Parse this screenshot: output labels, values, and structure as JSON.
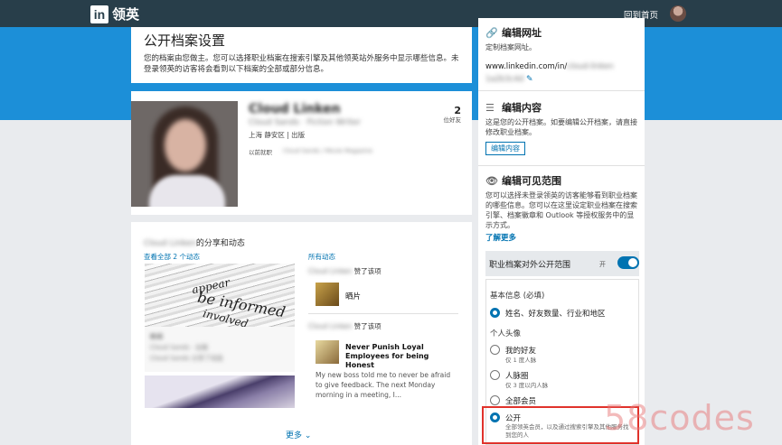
{
  "topbar": {
    "logo_mark": "in",
    "logo_text": "领英",
    "home_link": "回到首页"
  },
  "title_card": {
    "title": "公开档案设置",
    "description": "您的档案由您做主。您可以选择职业档案在搜索引擎及其他领英站外服务中显示哪些信息。未登录领英的访客将会看到以下档案的全部或部分信息。"
  },
  "profile": {
    "name": "Cloud Linken",
    "headline": "Cloud Sands · Fiction Writer",
    "location": "上海 静安区 | 出版",
    "previous_label": "以前就职",
    "previous_value": "Cloud Sands / Movie Magazine",
    "connections": "2",
    "connections_label": "位好友"
  },
  "activity": {
    "owner": "Cloud Linken",
    "title_suffix": "的分享和动态",
    "left_label": "查看全部 2 个动态",
    "right_label": "所有动态",
    "news_words": [
      "be informed",
      "involved",
      "appear"
    ],
    "left_lines": [
      "新闻",
      "Cloud Sands · 出版",
      "Cloud Sands 分享了动态"
    ],
    "feed": [
      {
        "actor": "Cloud Linken",
        "verb": "赞了该项",
        "title": "晒片"
      },
      {
        "actor": "Cloud Linken",
        "verb": "赞了该项",
        "title": "Never Punish Loyal Employees for being Honest",
        "desc": "My new boss told me to never be afraid to give feedback. The next Monday morning in a meeting, I..."
      }
    ],
    "more_label": "更多",
    "more_icon": "chevron-down-icon"
  },
  "sidebar": {
    "edit_url": {
      "title": "编辑网址",
      "icon": "link-icon",
      "desc": "定制档案网址。",
      "url_prefix": "www.linkedin.com/in/",
      "url_slug": "cloud-linken",
      "url_line2": "1a2b3c4d"
    },
    "edit_content": {
      "title": "编辑内容",
      "icon": "lines-icon",
      "desc": "这是您的公开档案。如要编辑公开档案，请直接修改职业档案。",
      "button": "编辑内容"
    },
    "visibility": {
      "title": "编辑可见范围",
      "icon": "eye-icon",
      "desc": "您可以选择未登录领英的访客能够看到职业档案的哪些信息。您可以在这里设定职业档案在搜索引擎、档案徽章和 Outlook 等授权服务中的显示方式。",
      "learn_more": "了解更多",
      "toggle_label": "职业档案对外公开范围",
      "toggle_state": "开",
      "basic_label": "基本信息 (必填)",
      "basic_option": "姓名、好友数量、行业和地区",
      "photo_label": "个人头像",
      "options": [
        {
          "label": "我的好友",
          "sub": "仅 1 度人脉",
          "selected": false
        },
        {
          "label": "人脉圈",
          "sub": "仅 3 度以内人脉",
          "selected": false
        },
        {
          "label": "全部会员",
          "sub": "",
          "selected": false
        },
        {
          "label": "公开",
          "sub": "全部领英会员，以及通过搜索引擎及其他服务找到您的人",
          "selected": true
        }
      ]
    }
  },
  "watermark": "58codes",
  "colors": {
    "topbar": "#283e4a",
    "hero": "#1c8fd8",
    "accent": "#0073b1",
    "highlight": "#e0322b"
  }
}
